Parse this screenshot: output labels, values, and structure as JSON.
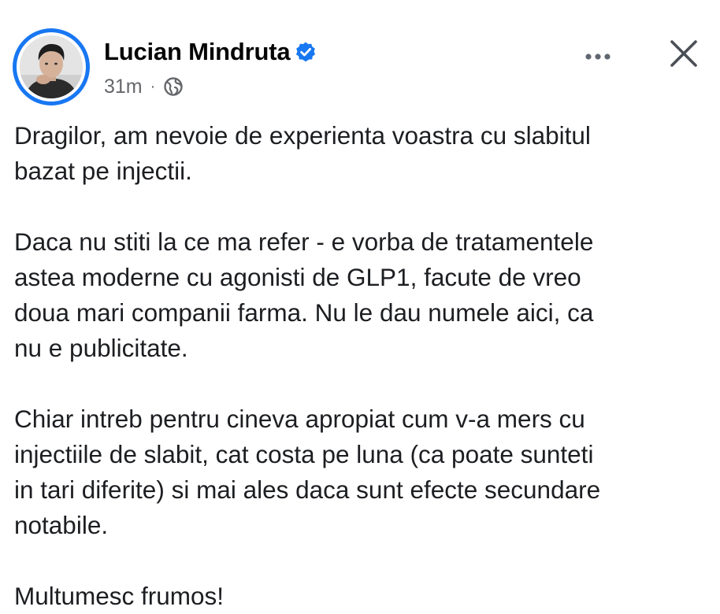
{
  "post": {
    "author": {
      "name": "Lucian Mindruta",
      "verified": true,
      "avatar": "profile-photo"
    },
    "meta": {
      "timestamp": "31m",
      "separator": "·",
      "audience_icon": "globe-icon"
    },
    "actions": {
      "more_icon": "more-horizontal-icon",
      "close_icon": "close-icon"
    },
    "paragraphs": [
      "Dragilor, am nevoie de experienta voastra cu slabitul\nbazat pe injectii.",
      "Daca nu stiti la ce ma refer - e vorba de tratamentele\nastea moderne cu agonisti de GLP1, facute de vreo\ndoua mari companii farma. Nu le dau numele aici, ca\nnu e publicitate.",
      "Chiar intreb pentru cineva apropiat cum v-a mers cu\ninjectiile de slabit, cat costa pe luna (ca poate sunteti\nin tari diferite) si mai ales daca sunt efecte secundare\nnotabile.",
      "Multumesc frumos!"
    ]
  },
  "colors": {
    "accent": "#1877f2",
    "text": "#1c1e21",
    "secondary_text": "#65676b",
    "background": "#ffffff"
  }
}
